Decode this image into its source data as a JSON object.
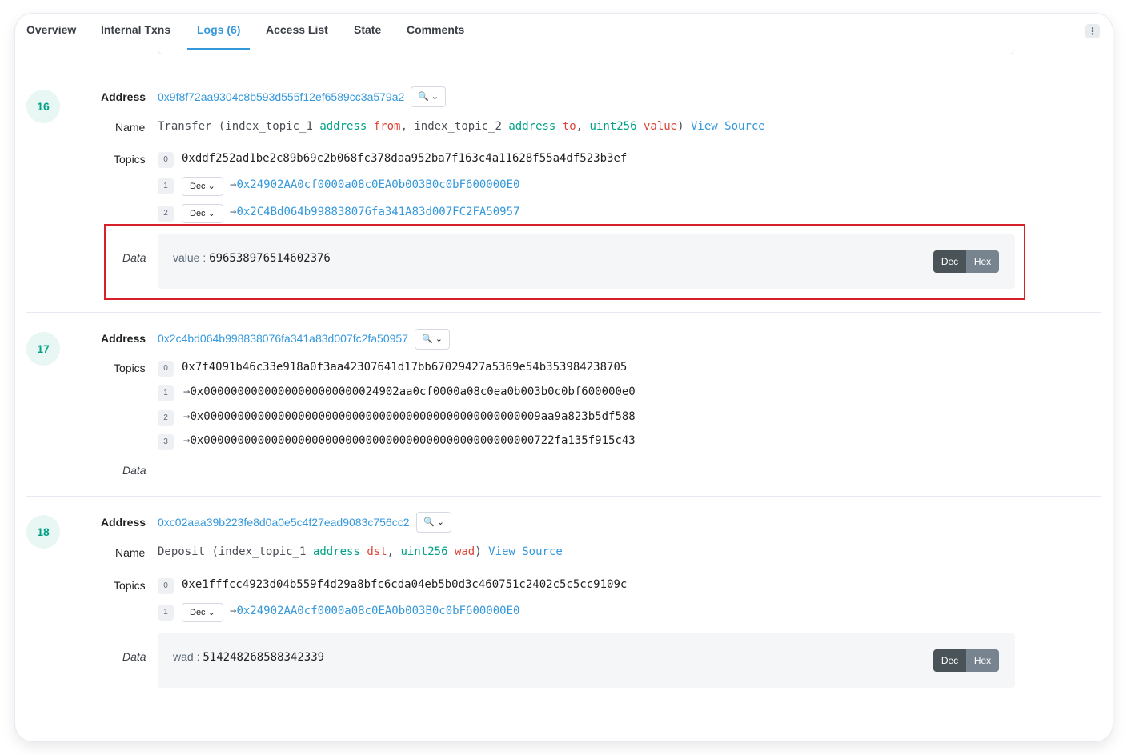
{
  "tabs": [
    {
      "label": "Overview"
    },
    {
      "label": "Internal Txns"
    },
    {
      "label": "Logs (6)"
    },
    {
      "label": "Access List"
    },
    {
      "label": "State"
    },
    {
      "label": "Comments"
    }
  ],
  "active_tab": "Logs (6)",
  "more_icon": "⋮",
  "labels": {
    "address": "Address",
    "name": "Name",
    "topics": "Topics",
    "data": "Data"
  },
  "toggle": {
    "dec": "Dec",
    "hex": "Hex"
  },
  "select_label": "Dec",
  "icons": {
    "search": "search-icon",
    "chevron": "chevron-down-icon",
    "arrow": "arrow-right-icon"
  },
  "colors": {
    "accent": "#3498db",
    "green": "#00a186",
    "red": "#de4437",
    "highlight": "#d6202a"
  },
  "logs": [
    {
      "index": "16",
      "address": "0x9f8f72aa9304c8b593d555f12ef6589cc3a579a2",
      "name": {
        "fn": "Transfer",
        "params": [
          {
            "prefix": "index_topic_1",
            "type": "address",
            "name": "from"
          },
          {
            "prefix": "index_topic_2",
            "type": "address",
            "name": "to"
          },
          {
            "prefix": "",
            "type": "uint256",
            "name": "value"
          }
        ],
        "view_source": "View Source"
      },
      "topics": [
        {
          "i": "0",
          "value": "0xddf252ad1be2c89b69c2b068fc378daa952ba7f163c4a11628f55a4df523b3ef"
        },
        {
          "i": "1",
          "value": "0x24902AA0cf0000a08c0EA0b003B0c0bF600000E0"
        },
        {
          "i": "2",
          "value": "0x2C4Bd064b998838076fa341A83d007FC2FA50957"
        }
      ],
      "data": {
        "key": "value",
        "value": "696538976514602376"
      }
    },
    {
      "index": "17",
      "address": "0x2c4bd064b998838076fa341a83d007fc2fa50957",
      "topics": [
        {
          "i": "0",
          "value": "0x7f4091b46c33e918a0f3aa42307641d17bb67029427a5369e54b353984238705"
        },
        {
          "i": "1",
          "value": "0x00000000000000000000000024902aa0cf0000a08c0ea0b003b0c0bf600000e0"
        },
        {
          "i": "2",
          "value": "0x00000000000000000000000000000000000000000000000009aa9a823b5df588"
        },
        {
          "i": "3",
          "value": "0x0000000000000000000000000000000000000000000000000722fa135f915c43"
        }
      ]
    },
    {
      "index": "18",
      "address": "0xc02aaa39b223fe8d0a0e5c4f27ead9083c756cc2",
      "name": {
        "fn": "Deposit",
        "params": [
          {
            "prefix": "index_topic_1",
            "type": "address",
            "name": "dst"
          },
          {
            "prefix": "",
            "type": "uint256",
            "name": "wad"
          }
        ],
        "view_source": "View Source"
      },
      "topics": [
        {
          "i": "0",
          "value": "0xe1fffcc4923d04b559f4d29a8bfc6cda04eb5b0d3c460751c2402c5c5cc9109c"
        },
        {
          "i": "1",
          "value": "0x24902AA0cf0000a08c0EA0b003B0c0bF600000E0"
        }
      ],
      "data": {
        "key": "wad",
        "value": "514248268588342339"
      }
    }
  ]
}
